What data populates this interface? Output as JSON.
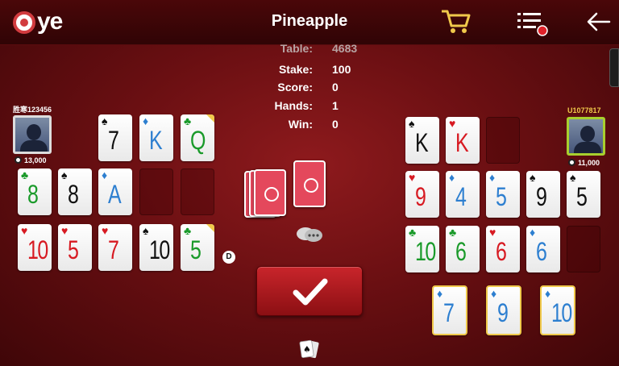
{
  "header": {
    "logo_text": "ye",
    "title": "Pineapple"
  },
  "icons": {
    "cart": "shopping-cart-icon",
    "menu": "menu-list-icon",
    "back": "back-arrow-icon"
  },
  "colors": {
    "accent_yellow": "#f0c94b",
    "table_red": "#8e1a1d",
    "menu_badge": "#e0222a",
    "active_player": "#a8cf2e"
  },
  "info": {
    "table_label": "Table:",
    "table_value": "4683",
    "stake_label": "Stake:",
    "stake_value": "100",
    "score_label": "Score:",
    "score_value": "0",
    "hands_label": "Hands:",
    "hands_value": "1",
    "win_label": "Win:",
    "win_value": "0"
  },
  "player_left": {
    "name": "胜寒123456",
    "chips": "13,000",
    "rows": {
      "top": [
        {
          "rank": "7",
          "suit": "♠",
          "color": "black"
        },
        {
          "rank": "K",
          "suit": "♦",
          "color": "blue"
        },
        {
          "rank": "Q",
          "suit": "♣",
          "color": "green"
        }
      ],
      "middle": [
        {
          "rank": "8",
          "suit": "♣",
          "color": "green"
        },
        {
          "rank": "8",
          "suit": "♠",
          "color": "black"
        },
        {
          "rank": "A",
          "suit": "♦",
          "color": "blue"
        }
      ],
      "bottom": [
        {
          "rank": "10",
          "suit": "♥",
          "color": "red"
        },
        {
          "rank": "5",
          "suit": "♥",
          "color": "red"
        },
        {
          "rank": "7",
          "suit": "♥",
          "color": "red"
        },
        {
          "rank": "10",
          "suit": "♠",
          "color": "black"
        },
        {
          "rank": "5",
          "suit": "♣",
          "color": "green"
        }
      ]
    },
    "dealer_label": "D"
  },
  "player_right": {
    "name": "U1077817",
    "chips": "11,000",
    "rows": {
      "top": [
        {
          "rank": "K",
          "suit": "♠",
          "color": "black"
        },
        {
          "rank": "K",
          "suit": "♥",
          "color": "red"
        }
      ],
      "middle": [
        {
          "rank": "9",
          "suit": "♥",
          "color": "red"
        },
        {
          "rank": "4",
          "suit": "♦",
          "color": "blue"
        },
        {
          "rank": "5",
          "suit": "♦",
          "color": "blue"
        },
        {
          "rank": "9",
          "suit": "♠",
          "color": "black"
        },
        {
          "rank": "5",
          "suit": "♠",
          "color": "black"
        }
      ],
      "bottom": [
        {
          "rank": "10",
          "suit": "♣",
          "color": "green"
        },
        {
          "rank": "6",
          "suit": "♣",
          "color": "green"
        },
        {
          "rank": "6",
          "suit": "♥",
          "color": "red"
        },
        {
          "rank": "6",
          "suit": "♦",
          "color": "blue"
        }
      ]
    }
  },
  "hand": [
    {
      "rank": "7",
      "suit": "♦",
      "color": "blue"
    },
    {
      "rank": "9",
      "suit": "♦",
      "color": "blue"
    },
    {
      "rank": "10",
      "suit": "♦",
      "color": "blue"
    }
  ]
}
